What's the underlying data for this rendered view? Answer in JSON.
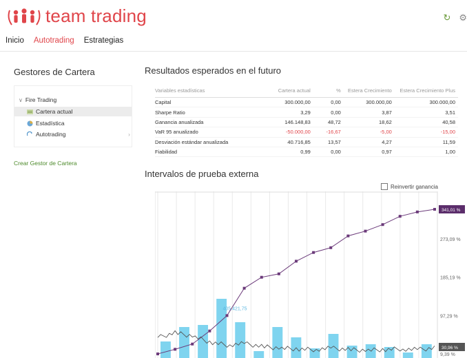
{
  "header": {
    "logo_text": "team trading",
    "refresh_icon": "refresh-icon",
    "settings_icon": "gear-icon",
    "brand_color": "#e0454a"
  },
  "nav": {
    "items": [
      "Inicio",
      "Autotrading",
      "Estrategias"
    ],
    "active": "Autotrading"
  },
  "sidebar": {
    "title": "Gestores de Cartera",
    "tree": [
      {
        "label": "Fire Trading",
        "icon": "chevron-down-icon"
      },
      {
        "label": "Cartera actual",
        "icon": "portfolio-icon",
        "selected": true
      },
      {
        "label": "Estadística",
        "icon": "pie-chart-icon"
      },
      {
        "label": "Autotrading",
        "icon": "autotrading-icon"
      }
    ],
    "create_link": "Crear Gestor de Cartera"
  },
  "results": {
    "title": "Resultados esperados en el futuro",
    "columns": [
      "Variables estadísticas",
      "Cartera actual",
      "%",
      "Estera Crecimiento",
      "Estera Crecimiento Plus"
    ],
    "rows": [
      [
        "Capital",
        "300.000,00",
        "0,00",
        "300.000,00",
        "300.000,00"
      ],
      [
        "Sharpe Ratio",
        "3,29",
        "0,00",
        "3,87",
        "3,51"
      ],
      [
        "Ganancia anualizada",
        "146.148,83",
        "48,72",
        "18,62",
        "40,58"
      ],
      [
        "VaR 95 anualizado",
        "-50.000,00",
        "-16,67",
        "-5,00",
        "-15,00"
      ],
      [
        "Desviación estándar anualizada",
        "40.716,85",
        "13,57",
        "4,27",
        "11,59"
      ],
      [
        "Fiabilidad",
        "0,99",
        "0,00",
        "0,97",
        "1,00"
      ]
    ],
    "negative_color": "#e0454a"
  },
  "intervals": {
    "title": "Intervalos de prueba externa",
    "reinvest_label": "Reinvertir ganancia",
    "reinvest_checked": false
  },
  "chart_data": {
    "type": "line",
    "series": [
      {
        "values": [
          9.39,
          20,
          32,
          62,
          97.29,
          160,
          185.19,
          193,
          222,
          242,
          253,
          280,
          291,
          306,
          325,
          335,
          341.01
        ],
        "color": "#6b3a7a"
      },
      {
        "values": [
          9,
          12,
          10,
          6,
          4,
          5,
          3,
          2,
          1.5,
          1,
          2,
          1,
          0.5,
          1,
          1.5,
          1,
          2
        ],
        "color": "#555555"
      }
    ],
    "bars": [
      24,
      45,
      48,
      86,
      52,
      10,
      45,
      30,
      14,
      35,
      18,
      20,
      16,
      8,
      20
    ],
    "bar_color": "#7fd4ef",
    "ylim": [
      0,
      360
    ],
    "y_ticks": [
      "273,09 %",
      "185,19 %",
      "97,29 %",
      "9,39 %"
    ],
    "y_tick_values": [
      273.09,
      185.19,
      97.29,
      9.39
    ],
    "last_value_label": "341,01 %",
    "last_value_label_2": "30,96 %",
    "point_annotation": "405.421,75"
  }
}
